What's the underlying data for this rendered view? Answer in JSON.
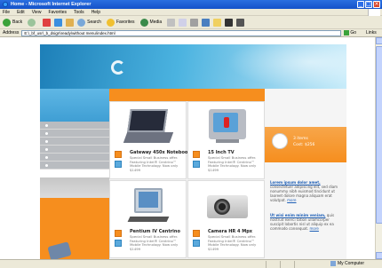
{
  "window": {
    "title": "Home - Microsoft Internet Explorer"
  },
  "menu": [
    "File",
    "Edit",
    "View",
    "Favorites",
    "Tools",
    "Help"
  ],
  "toolbar": {
    "back_label": "Back",
    "search_label": "Search",
    "favorites_label": "Favorites",
    "media_label": "Media"
  },
  "address": {
    "label": "Address",
    "url": "E:\\_bf_usr\\_b_dsign\\ready\\without menu\\index.html",
    "go_label": "Go",
    "links_label": "Links"
  },
  "products": [
    {
      "name": "Gateway 450x Notebook",
      "desc": "Special Small Business offer. Featuring Intel® Centrino™ Mobile Technology. Now only $1499"
    },
    {
      "name": "15 Inch TV",
      "desc": "Special Small Business offer. Featuring Intel® Centrino™ Mobile Technology. Now only $1499"
    },
    {
      "name": "Pentium IV Centrino",
      "desc": "Special Small Business offer. Featuring Intel® Centrino™ Mobile Technology. Now only $1499"
    },
    {
      "name": "Camera HR 4 Mpx",
      "desc": "Special Small Business offer. Featuring Intel® Centrino™ Mobile Technology. Now only $1499"
    }
  ],
  "cart": {
    "items": "3 items",
    "cost": "Cost: $256"
  },
  "news": [
    {
      "title": "Lorem ipsum dolor amet,",
      "body": "consectetuer adipiscing elit, sed diam nonummy nibh euismod tincidunt ut laoreet dolore magna aliquam erat volutpat.",
      "more": "more"
    },
    {
      "title": "Ut wisi enim minim veniam,",
      "body": "quis nostrud exerci tation ullamcorper suscipit lobortis nisl ut aliquip ex ea commodo consequat.",
      "more": "more"
    }
  ],
  "status": {
    "zone": "My Computer"
  },
  "colors": {
    "accent_orange": "#f68e1e",
    "header_blue": "#1d7fb8",
    "link_blue": "#1e5fb6"
  }
}
